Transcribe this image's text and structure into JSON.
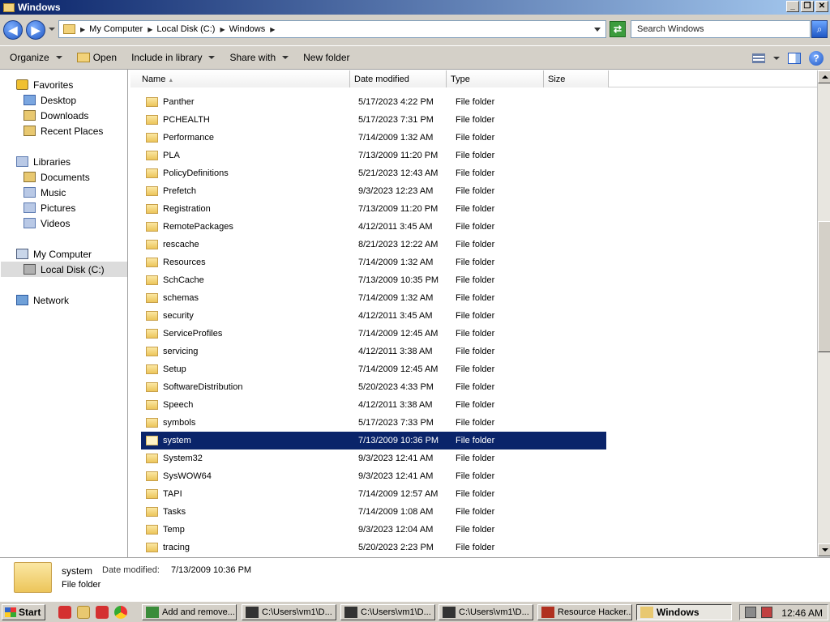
{
  "window": {
    "title": "Windows",
    "minimize": "_",
    "maximize": "❐",
    "close": "✕"
  },
  "address": {
    "back": "◀",
    "forward": "▶",
    "breadcrumbs": [
      "My Computer",
      "Local Disk (C:)",
      "Windows"
    ],
    "refresh": "⇄",
    "search_placeholder": "Search Windows",
    "search_btn": "⌕"
  },
  "toolbar": {
    "organize": "Organize",
    "open": "Open",
    "include_in_library": "Include in library",
    "share_with": "Share with",
    "new_folder": "New folder",
    "help": "?"
  },
  "navpane": {
    "items": [
      {
        "label": "Favorites",
        "icon": "star-icon"
      },
      {
        "label": "Desktop",
        "icon": "desktop-icon"
      },
      {
        "label": "Downloads",
        "icon": "downloads-icon"
      },
      {
        "label": "Recent Places",
        "icon": "recent-places-icon"
      },
      {
        "label": "Libraries",
        "icon": "libraries-icon"
      },
      {
        "label": "Documents",
        "icon": "documents-icon"
      },
      {
        "label": "Music",
        "icon": "music-icon"
      },
      {
        "label": "Pictures",
        "icon": "pictures-icon"
      },
      {
        "label": "Videos",
        "icon": "videos-icon"
      },
      {
        "label": "My Computer",
        "icon": "computer-icon"
      },
      {
        "label": "Local Disk (C:)",
        "icon": "disk-icon"
      },
      {
        "label": "Network",
        "icon": "network-icon"
      }
    ],
    "selected": "Local Disk (C:)"
  },
  "columns": {
    "name": "Name",
    "sort_arrow": "▲",
    "date_modified": "Date modified",
    "type": "Type",
    "size": "Size"
  },
  "files": [
    {
      "name": "Panther",
      "date": "5/17/2023 4:22 PM",
      "type": "File folder"
    },
    {
      "name": "PCHEALTH",
      "date": "5/17/2023 7:31 PM",
      "type": "File folder"
    },
    {
      "name": "Performance",
      "date": "7/14/2009 1:32 AM",
      "type": "File folder"
    },
    {
      "name": "PLA",
      "date": "7/13/2009 11:20 PM",
      "type": "File folder"
    },
    {
      "name": "PolicyDefinitions",
      "date": "5/21/2023 12:43 AM",
      "type": "File folder"
    },
    {
      "name": "Prefetch",
      "date": "9/3/2023 12:23 AM",
      "type": "File folder"
    },
    {
      "name": "Registration",
      "date": "7/13/2009 11:20 PM",
      "type": "File folder"
    },
    {
      "name": "RemotePackages",
      "date": "4/12/2011 3:45 AM",
      "type": "File folder"
    },
    {
      "name": "rescache",
      "date": "8/21/2023 12:22 AM",
      "type": "File folder"
    },
    {
      "name": "Resources",
      "date": "7/14/2009 1:32 AM",
      "type": "File folder"
    },
    {
      "name": "SchCache",
      "date": "7/13/2009 10:35 PM",
      "type": "File folder"
    },
    {
      "name": "schemas",
      "date": "7/14/2009 1:32 AM",
      "type": "File folder"
    },
    {
      "name": "security",
      "date": "4/12/2011 3:45 AM",
      "type": "File folder"
    },
    {
      "name": "ServiceProfiles",
      "date": "7/14/2009 12:45 AM",
      "type": "File folder"
    },
    {
      "name": "servicing",
      "date": "4/12/2011 3:38 AM",
      "type": "File folder"
    },
    {
      "name": "Setup",
      "date": "7/14/2009 12:45 AM",
      "type": "File folder"
    },
    {
      "name": "SoftwareDistribution",
      "date": "5/20/2023 4:33 PM",
      "type": "File folder"
    },
    {
      "name": "Speech",
      "date": "4/12/2011 3:38 AM",
      "type": "File folder"
    },
    {
      "name": "symbols",
      "date": "5/17/2023 7:33 PM",
      "type": "File folder"
    },
    {
      "name": "system",
      "date": "7/13/2009 10:36 PM",
      "type": "File folder",
      "selected": true
    },
    {
      "name": "System32",
      "date": "9/3/2023 12:41 AM",
      "type": "File folder"
    },
    {
      "name": "SysWOW64",
      "date": "9/3/2023 12:41 AM",
      "type": "File folder"
    },
    {
      "name": "TAPI",
      "date": "7/14/2009 12:57 AM",
      "type": "File folder"
    },
    {
      "name": "Tasks",
      "date": "7/14/2009 1:08 AM",
      "type": "File folder"
    },
    {
      "name": "Temp",
      "date": "9/3/2023 12:04 AM",
      "type": "File folder"
    },
    {
      "name": "tracing",
      "date": "5/20/2023 2:23 PM",
      "type": "File folder"
    }
  ],
  "details": {
    "name": "system",
    "modified_label": "Date modified:",
    "modified_value": "7/13/2009 10:36 PM",
    "type": "File folder"
  },
  "taskbar": {
    "start": "Start",
    "tasks": [
      {
        "label": "Add and remove...",
        "icon": "chrome-icon",
        "color": "#3a8c3a"
      },
      {
        "label": "C:\\Users\\vm1\\D...",
        "icon": "7zip-icon",
        "color": "#333333"
      },
      {
        "label": "C:\\Users\\vm1\\D...",
        "icon": "7zip-icon",
        "color": "#333333"
      },
      {
        "label": "C:\\Users\\vm1\\D...",
        "icon": "7zip-icon",
        "color": "#333333"
      },
      {
        "label": "Resource Hacker...",
        "icon": "resource-hacker-icon",
        "color": "#b03020"
      },
      {
        "label": "Windows",
        "icon": "folder-icon",
        "color": "#e8c870",
        "active": true
      }
    ],
    "clock": "12:46 AM"
  },
  "colors": {
    "selection": "#0a246a",
    "title_start": "#0a246a",
    "title_end": "#a6caf0",
    "chrome": "#d4d0c8"
  }
}
